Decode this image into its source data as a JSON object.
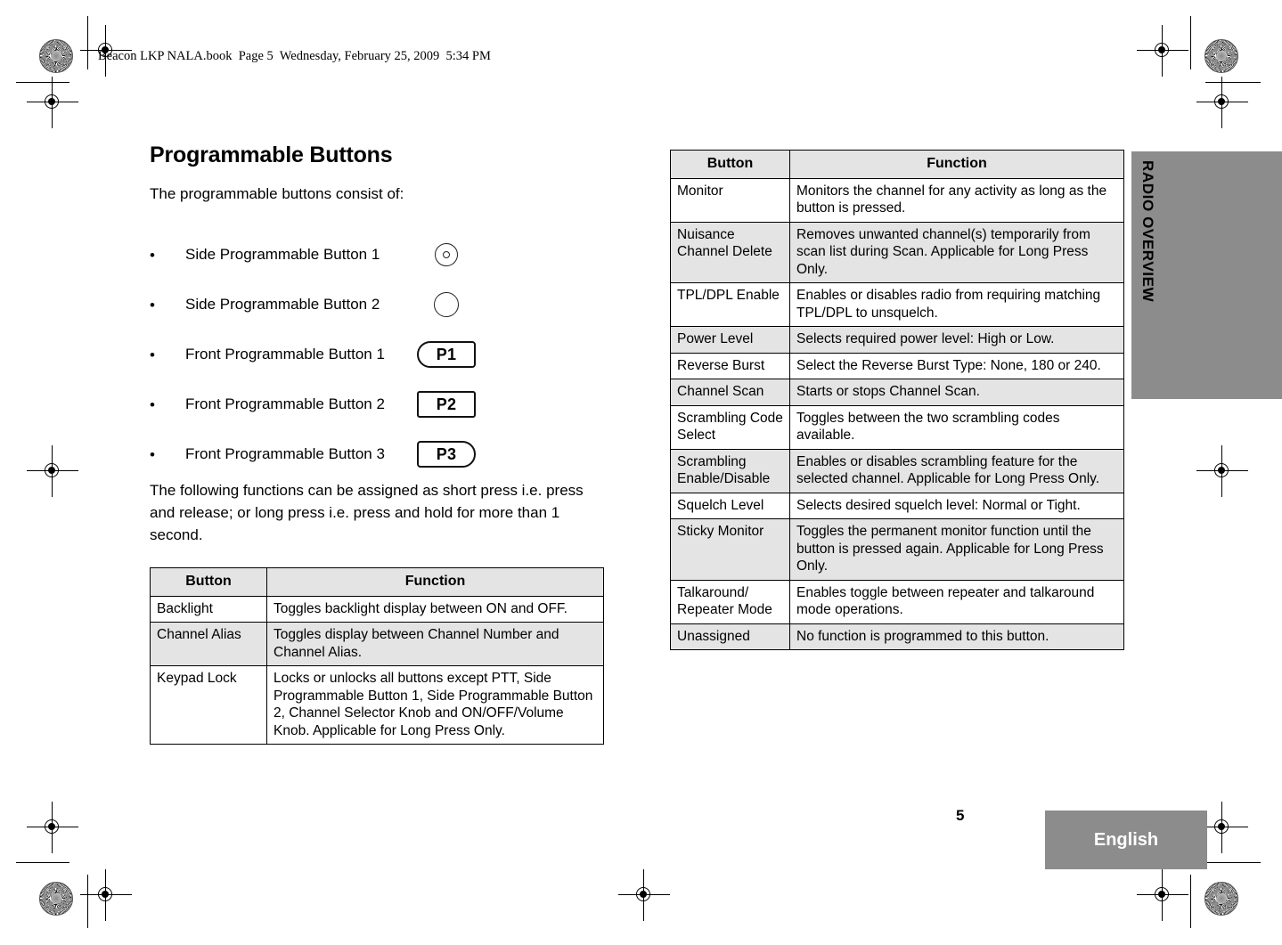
{
  "header": {
    "running_head": "Beacon LKP NALA.book  Page 5  Wednesday, February 25, 2009  5:34 PM"
  },
  "side_tab": {
    "label": "RADIO OVERVIEW",
    "color": "#8c8c8c"
  },
  "footer": {
    "page_number": "5",
    "language": "English",
    "language_block_color": "#8c8c8c"
  },
  "main": {
    "title": "Programmable Buttons",
    "intro": "The programmable buttons consist of:",
    "bullets": [
      {
        "marker": "•",
        "label": "Side Programmable Button 1",
        "icon": "knob-with-dot-icon",
        "icon_text": ""
      },
      {
        "marker": "•",
        "label": "Side Programmable Button 2",
        "icon": "plain-knob-icon",
        "icon_text": ""
      },
      {
        "marker": "•",
        "label": "Front Programmable Button 1",
        "icon": "p1-key-icon",
        "icon_text": "P1"
      },
      {
        "marker": "•",
        "label": "Front Programmable Button 2",
        "icon": "p2-key-icon",
        "icon_text": "P2"
      },
      {
        "marker": "•",
        "label": "Front Programmable Button 3",
        "icon": "p3-key-icon",
        "icon_text": "P3"
      }
    ],
    "press_note": "The following functions can be assigned as short press i.e. press and release; or long press i.e. press and hold for more than 1 second."
  },
  "table_left": {
    "headers": [
      "Button",
      "Function"
    ],
    "rows": [
      {
        "button": "Backlight",
        "function": "Toggles backlight display between ON and OFF.",
        "shaded": false
      },
      {
        "button": "Channel Alias",
        "function": "Toggles display between Channel Number and Channel Alias.",
        "shaded": true
      },
      {
        "button": "Keypad Lock",
        "function": "Locks or unlocks all buttons except PTT, Side Programmable Button 1, Side Programmable Button 2, Channel Selector Knob and ON/OFF/Volume Knob. Applicable for Long Press Only.",
        "shaded": false
      }
    ]
  },
  "table_right": {
    "headers": [
      "Button",
      "Function"
    ],
    "rows": [
      {
        "button": "Monitor",
        "function": "Monitors the channel for any activity as long as the button is pressed.",
        "shaded": false
      },
      {
        "button": "Nuisance Channel Delete",
        "function": "Removes unwanted channel(s) temporarily from scan list during Scan. Applicable for Long Press Only.",
        "shaded": true
      },
      {
        "button": "TPL/DPL Enable",
        "function": "Enables or disables radio from requiring matching TPL/DPL to unsquelch.",
        "shaded": false
      },
      {
        "button": "Power Level",
        "function": "Selects required power level: High or Low.",
        "shaded": true
      },
      {
        "button": "Reverse Burst",
        "function": "Select the Reverse Burst Type: None, 180 or 240.",
        "shaded": false
      },
      {
        "button": "Channel Scan",
        "function": "Starts or stops Channel Scan.",
        "shaded": true
      },
      {
        "button": "Scrambling Code Select",
        "function": "Toggles between the two scrambling codes available.",
        "shaded": false
      },
      {
        "button": "Scrambling Enable/Disable",
        "function": "Enables or disables scrambling feature for the selected channel. Applicable for Long Press Only.",
        "shaded": true
      },
      {
        "button": "Squelch Level",
        "function": "Selects desired squelch level: Normal or Tight.",
        "shaded": false
      },
      {
        "button": "Sticky Monitor",
        "function": "Toggles the permanent monitor function until the button is pressed again. Applicable for Long Press Only.",
        "shaded": true
      },
      {
        "button": "Talkaround/ Repeater Mode",
        "function": "Enables toggle between repeater and talkaround mode operations.",
        "shaded": false
      },
      {
        "button": "Unassigned",
        "function": "No function is programmed to this button.",
        "shaded": true
      }
    ]
  }
}
